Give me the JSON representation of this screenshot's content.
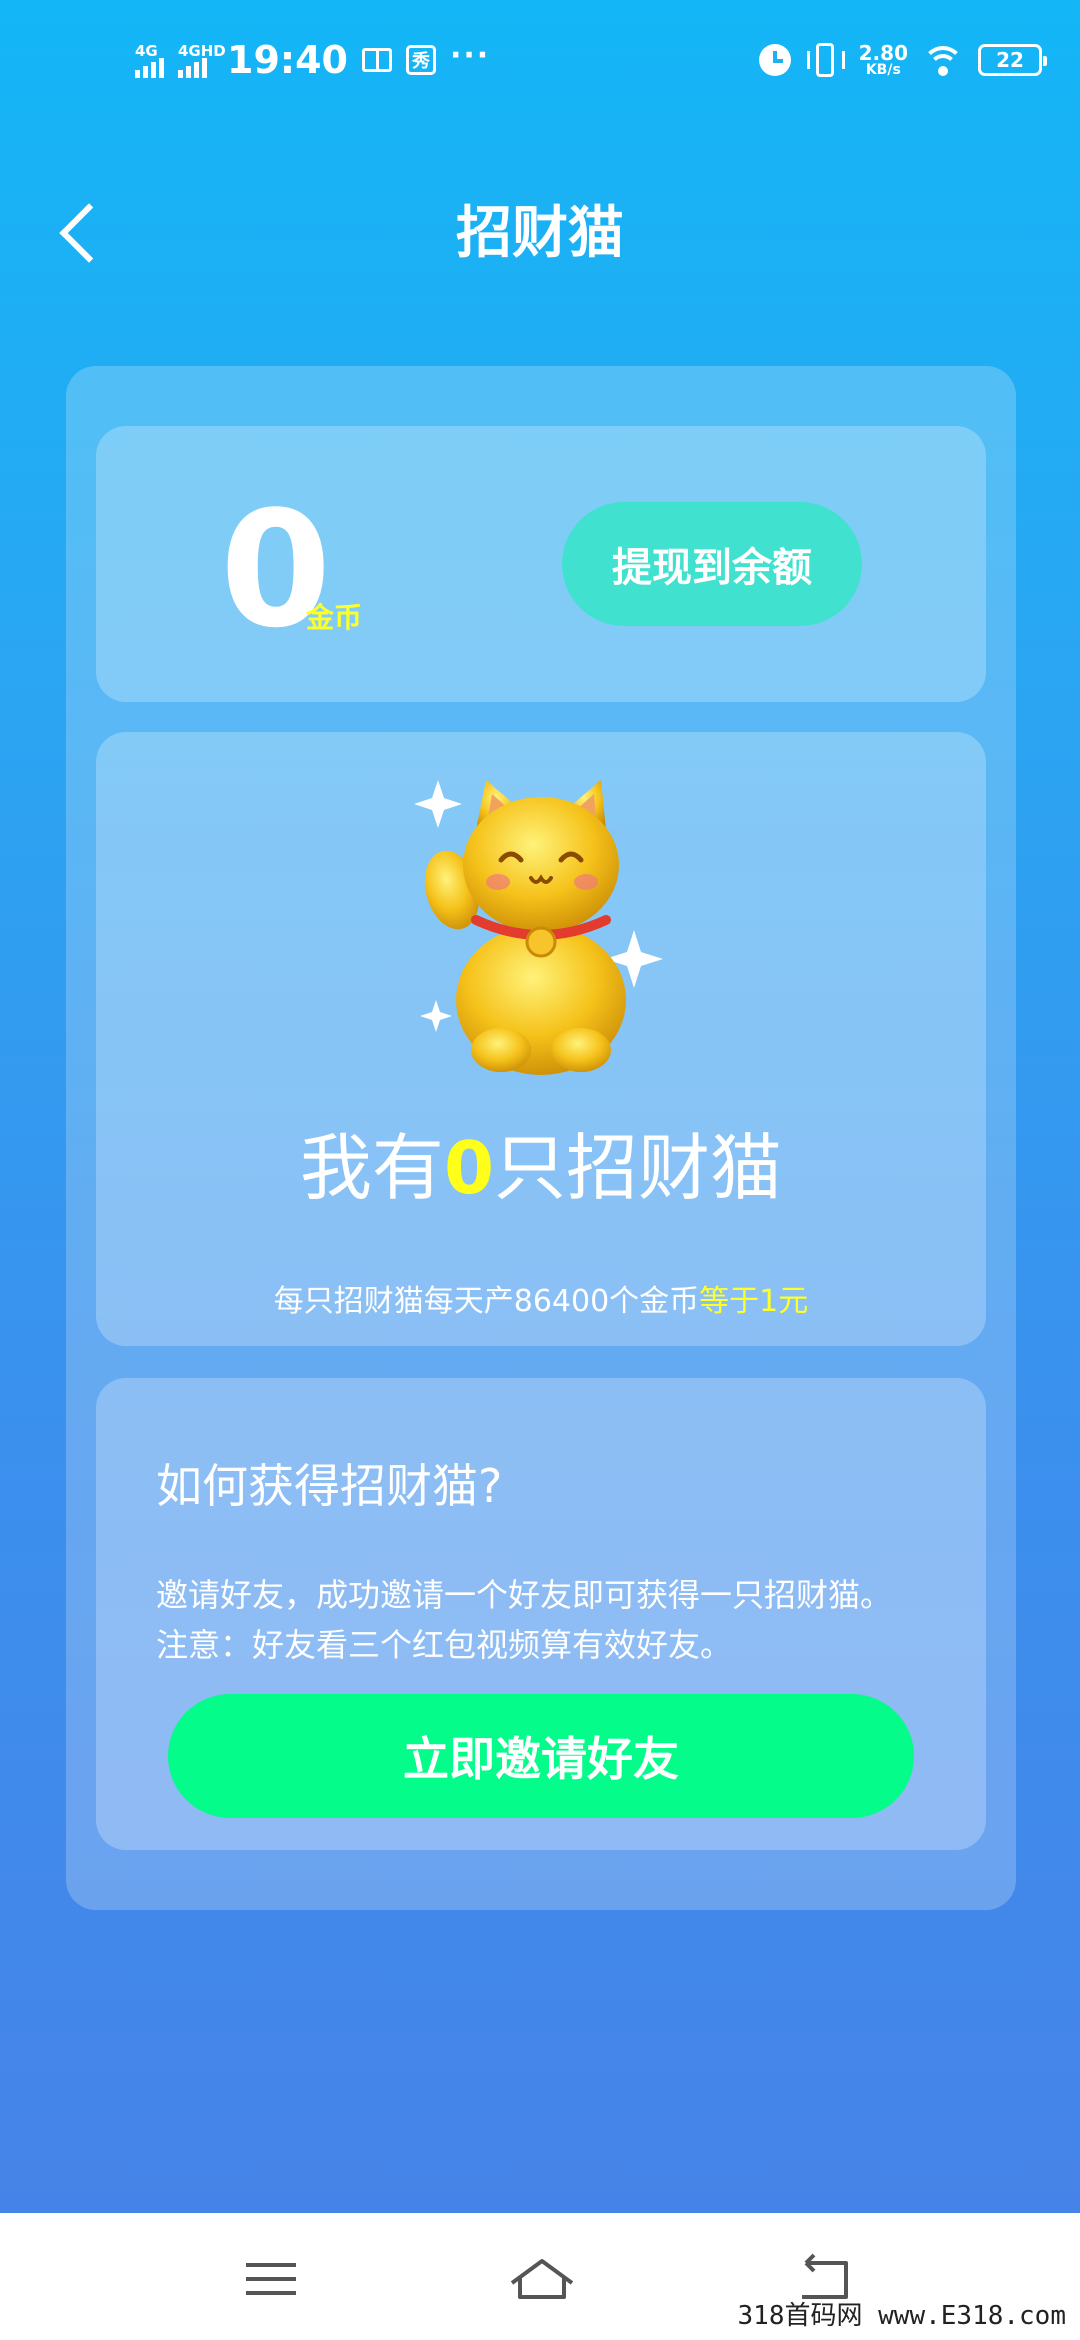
{
  "status_bar": {
    "network_1": "4G",
    "network_2": "4GHD",
    "time": "19:40",
    "xiu_label": "秀",
    "dots": "···",
    "speed_value": "2.80",
    "speed_unit": "KB/s",
    "battery": "22"
  },
  "header": {
    "title": "招财猫"
  },
  "coins": {
    "amount": "0",
    "unit": "金币",
    "withdraw_label": "提现到余额"
  },
  "cat_card": {
    "headline_prefix": "我有",
    "count": "0",
    "headline_suffix": "只招财猫",
    "sub_text": "每只招财猫每天产86400个金币",
    "sub_highlight": "等于1元"
  },
  "howto": {
    "title": "如何获得招财猫?",
    "line1": "邀请好友，成功邀请一个好友即可获得一只招财猫。",
    "line2": "注意：好友看三个红包视频算有效好友。",
    "invite_label": "立即邀请好友"
  },
  "watermark": "318首码网 www.E318.com",
  "colors": {
    "accent_yellow": "#ffff2a",
    "withdraw_btn": "#40e1cf",
    "invite_btn": "#04fc8a"
  },
  "icons": [
    "back-icon",
    "alarm-icon",
    "vibrate-icon",
    "wifi-icon",
    "battery-icon",
    "menu-icon",
    "home-icon",
    "return-icon",
    "lucky-cat-image"
  ]
}
